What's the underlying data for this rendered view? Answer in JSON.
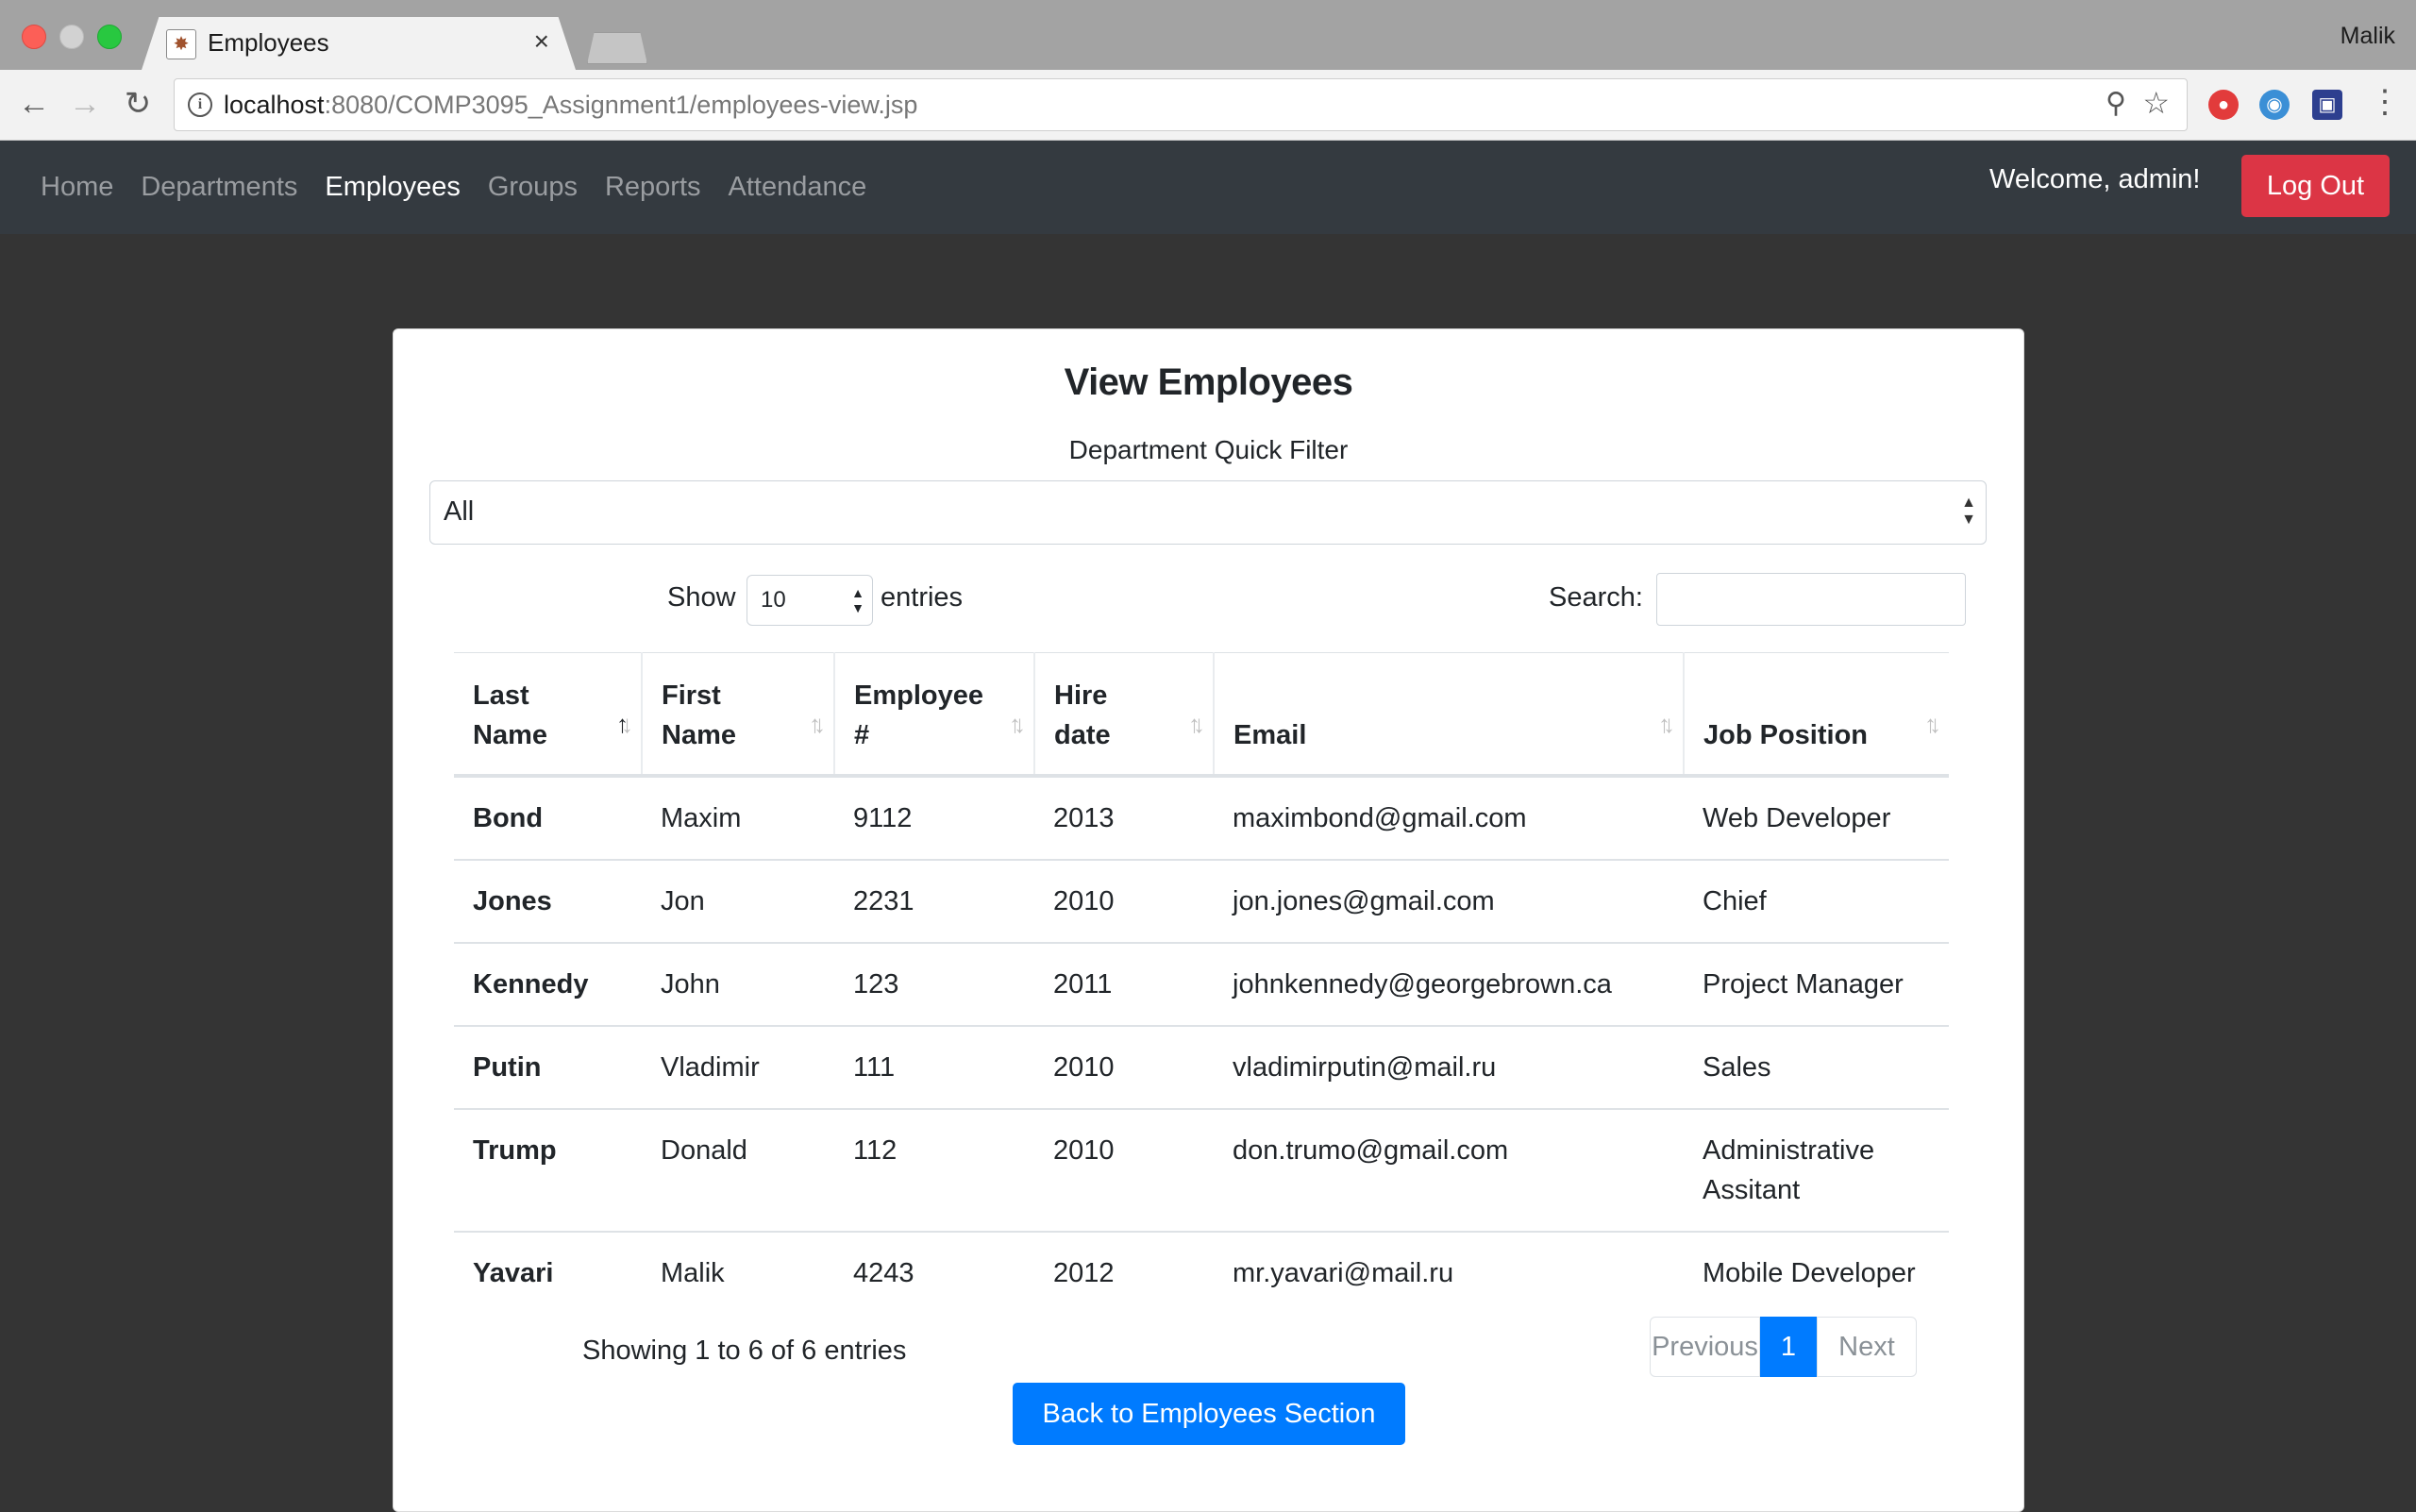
{
  "browser": {
    "tab_title": "Employees",
    "tab_close": "×",
    "profile_name": "Malik",
    "url_host": "localhost",
    "url_rest": ":8080/COMP3095_Assignment1/employees-view.jsp",
    "back_glyph": "←",
    "forward_glyph": "→",
    "reload_glyph": "↻",
    "info_glyph": "i",
    "zoom_glyph": "⚲",
    "star_glyph": "☆",
    "menu_glyph": "⋮"
  },
  "navbar": {
    "links": [
      "Home",
      "Departments",
      "Employees",
      "Groups",
      "Reports",
      "Attendance"
    ],
    "active": "Employees",
    "welcome": "Welcome, admin!",
    "logout_label": "Log Out"
  },
  "page": {
    "title": "View Employees",
    "filter_label": "Department Quick Filter",
    "filter_value": "All",
    "show_label": "Show",
    "page_length": "10",
    "entries_label": "entries",
    "search_label": "Search:",
    "search_value": ""
  },
  "table": {
    "columns": [
      {
        "line1": "Last",
        "line2": "Name"
      },
      {
        "line1": "First",
        "line2": "Name"
      },
      {
        "line1": "Employee",
        "line2": "#"
      },
      {
        "line1": "Hire",
        "line2": "date"
      },
      {
        "line1": "",
        "line2": "Email"
      },
      {
        "line1": "",
        "line2": "Job Position"
      }
    ],
    "sorted_column": 0,
    "sort_direction": "ascending",
    "rows": [
      [
        "Bond",
        "Maxim",
        "9112",
        "2013",
        "maximbond@gmail.com",
        "Web Developer"
      ],
      [
        "Jones",
        "Jon",
        "2231",
        "2010",
        "jon.jones@gmail.com",
        "Chief"
      ],
      [
        "Kennedy",
        "John",
        "123",
        "2011",
        "johnkennedy@georgebrown.ca",
        "Project Manager"
      ],
      [
        "Putin",
        "Vladimir",
        "111",
        "2010",
        "vladimirputin@mail.ru",
        "Sales"
      ],
      [
        "Trump",
        "Donald",
        "112",
        "2010",
        "don.trumo@gmail.com",
        "Administrative Assitant"
      ],
      [
        "Yavari",
        "Malik",
        "4243",
        "2012",
        "mr.yavari@mail.ru",
        "Mobile Developer"
      ]
    ]
  },
  "footer": {
    "info": "Showing 1 to 6 of 6 entries",
    "prev_label": "Previous",
    "current_page": "1",
    "next_label": "Next",
    "back_label": "Back to Employees Section"
  },
  "colors": {
    "navbar_bg": "#343a40",
    "danger": "#dc3545",
    "primary": "#007bff",
    "page_bg": "#343434"
  }
}
